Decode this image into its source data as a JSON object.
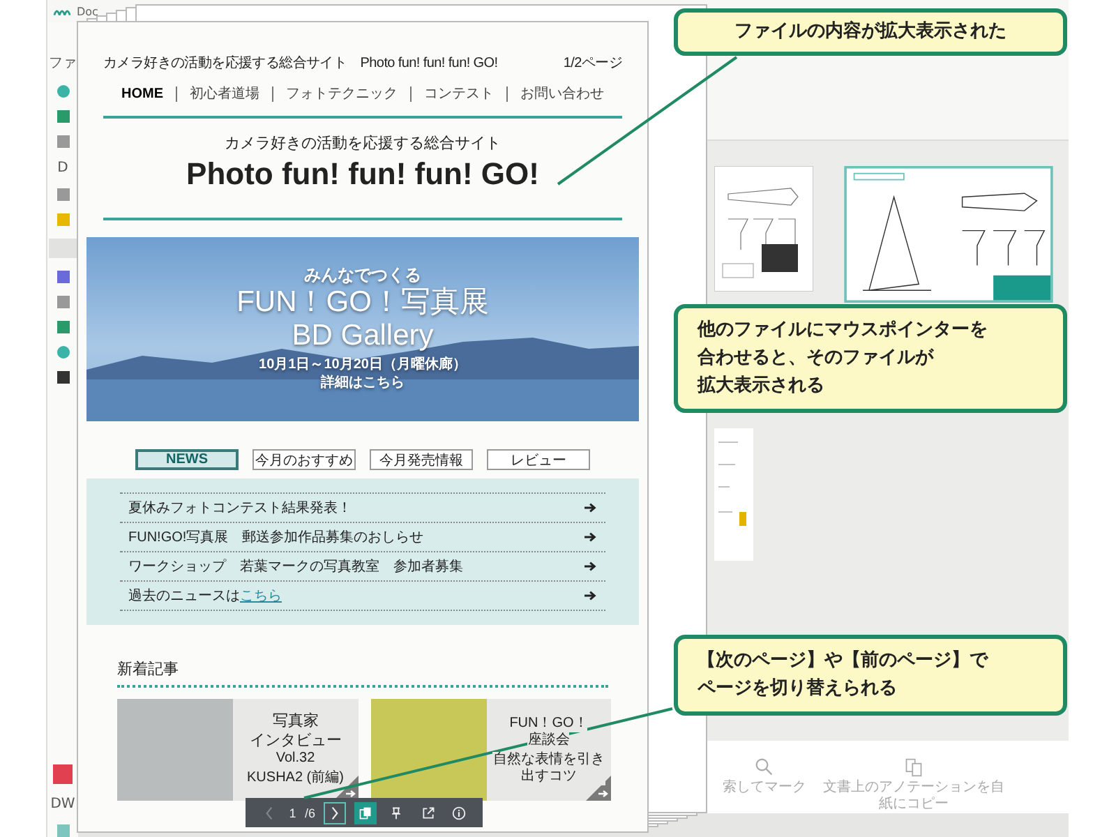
{
  "app": {
    "title": "Doc",
    "menu_label": "ファ",
    "section_label": "D",
    "bottom_label": "DW",
    "tools": [
      {
        "kind": "search",
        "lines": [
          "索してマーク"
        ]
      },
      {
        "kind": "copy",
        "lines": [
          "文書上のアノテーションを自",
          "紙にコピー"
        ]
      }
    ]
  },
  "preview": {
    "header_text": "カメラ好きの活動を応援する総合サイト　Photo fun! fun! fun! GO!",
    "page_indicator": "1/2ページ",
    "nav": [
      {
        "label": "HOME",
        "selected": true
      },
      {
        "label": "初心者道場",
        "selected": false
      },
      {
        "label": "フォトテクニック",
        "selected": false
      },
      {
        "label": "コンテスト",
        "selected": false
      },
      {
        "label": "お問い合わせ",
        "selected": false
      }
    ],
    "tagline": "カメラ好きの活動を応援する総合サイト",
    "site_title": "Photo fun! fun! fun! GO!",
    "banner": {
      "kicker": "みんなでつくる",
      "title": "FUN！GO！写真展",
      "subtitle": "BD Gallery",
      "dates": "10月1日～10月20日（月曜休廊）",
      "link": "詳細はこちら"
    },
    "tabs": [
      {
        "label": "NEWS",
        "selected": true
      },
      {
        "label": "今月のおすすめ",
        "selected": false
      },
      {
        "label": "今月発売情報",
        "selected": false
      },
      {
        "label": "レビュー",
        "selected": false
      }
    ],
    "news": [
      {
        "text": "夏休みフォトコンテスト結果発表！"
      },
      {
        "text": "FUN!GO!写真展　郵送参加作品募集のおしらせ"
      },
      {
        "text": "ワークショップ　若葉マークの写真教室　参加者募集"
      },
      {
        "text": "過去のニュースは",
        "link": "こちら"
      }
    ],
    "articles_heading": "新着記事",
    "articles": [
      {
        "lines": [
          {
            "text": "写真家",
            "kind": "title"
          },
          {
            "text": "インタビュー",
            "kind": "title"
          },
          {
            "text": "Vol.32",
            "kind": "sub"
          },
          {
            "text": "KUSHA2 (前編)",
            "kind": "note"
          }
        ]
      },
      {
        "lines": [
          {
            "text": "FUN！GO！",
            "kind": "sub"
          },
          {
            "text": "座談会",
            "kind": "sub"
          },
          {
            "text": "自然な表情を引き出すコツ",
            "kind": "note"
          }
        ]
      }
    ],
    "toolbar": {
      "page": "1",
      "total": "/6",
      "nav": [
        {
          "kind": "prev",
          "disabled": true
        },
        {
          "kind": "next",
          "disabled": false
        }
      ],
      "tools": [
        {
          "kind": "pages",
          "selected": true
        },
        {
          "kind": "pin",
          "selected": false
        },
        {
          "kind": "open",
          "selected": false
        },
        {
          "kind": "info",
          "selected": false
        }
      ]
    }
  },
  "callouts": [
    {
      "lines": [
        "ファイルの内容が拡大表示された"
      ]
    },
    {
      "lines": [
        "他のファイルにマウスポインターを",
        "合わせると、そのファイルが",
        "拡大表示される"
      ]
    },
    {
      "lines": [
        "【次のページ】や【前のページ】で",
        "ページを切り替えられる"
      ]
    }
  ]
}
